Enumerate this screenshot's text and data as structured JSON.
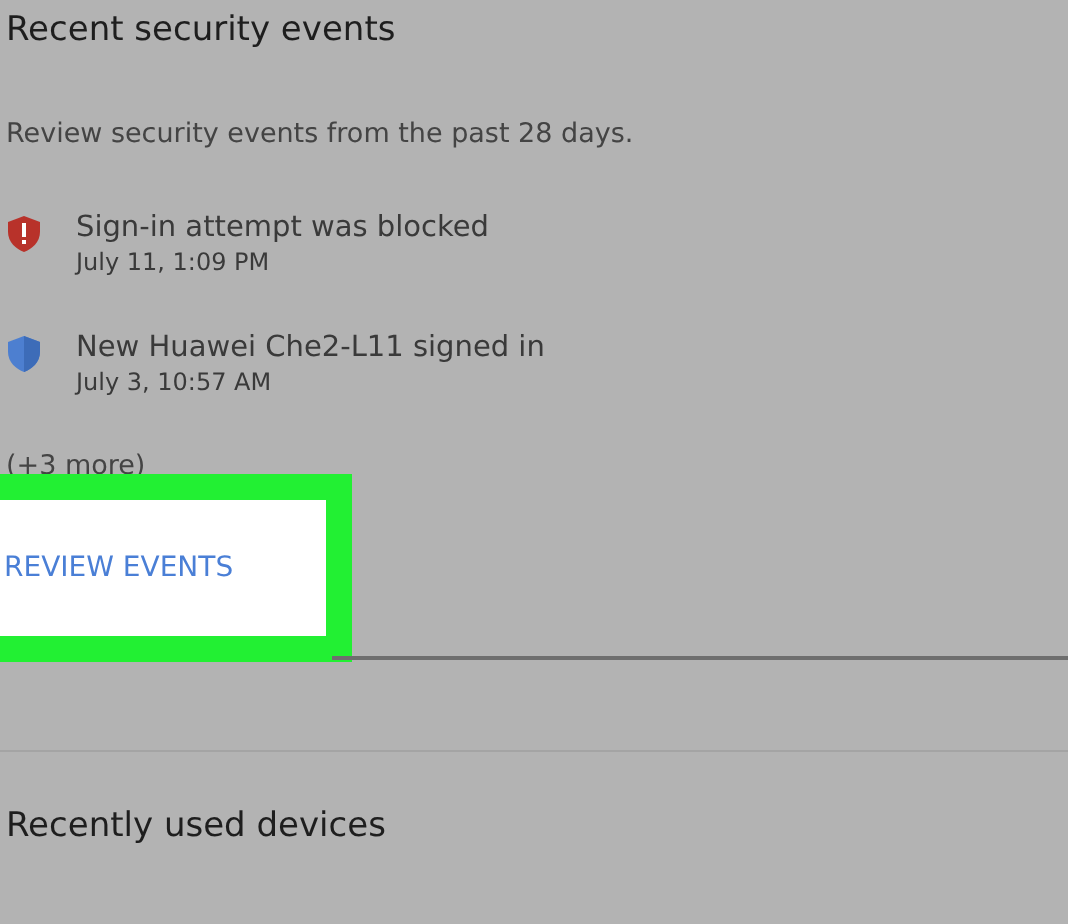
{
  "security": {
    "title": "Recent security events",
    "description": "Review security events from the past 28 days.",
    "events": [
      {
        "kind": "blocked",
        "title": "Sign-in attempt was blocked",
        "time": "July 11, 1:09 PM"
      },
      {
        "kind": "signin",
        "title": "New Huawei Che2-L11 signed in",
        "time": "July 3, 10:57 AM"
      }
    ],
    "more": "(+3 more)",
    "action": {
      "label": "REVIEW EVENTS",
      "highlighted": true
    }
  },
  "devices": {
    "title": "Recently used devices"
  }
}
